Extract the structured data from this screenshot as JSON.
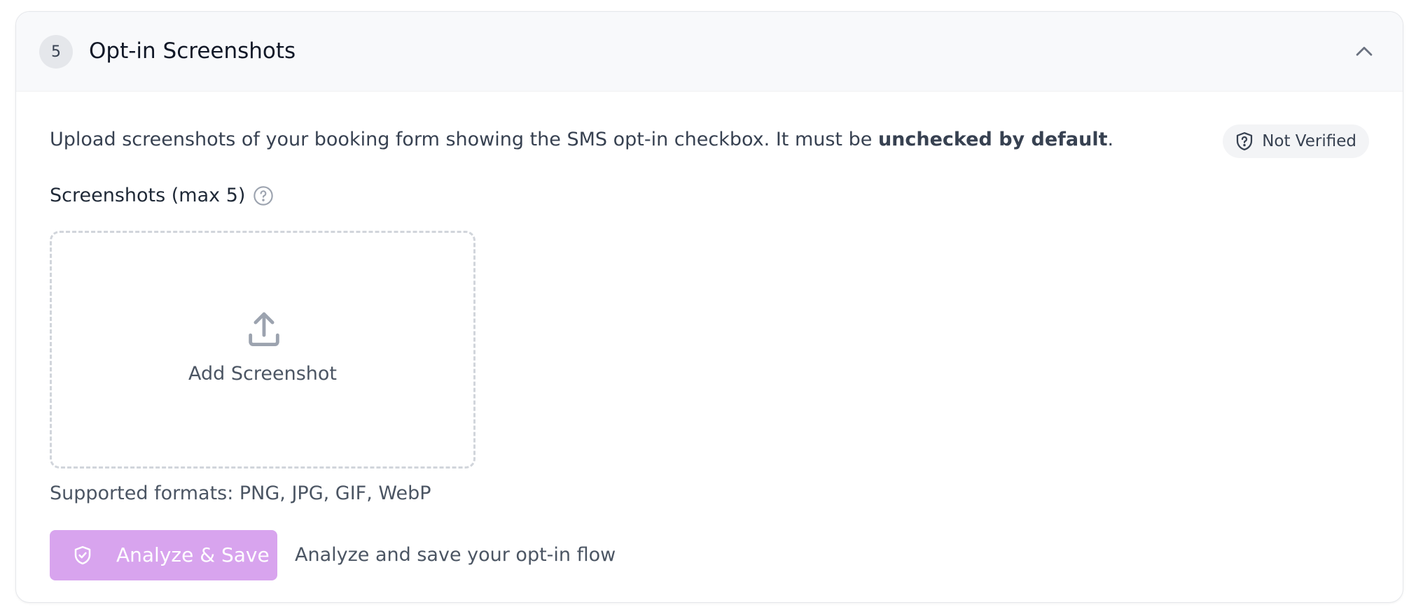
{
  "section": {
    "step_number": "5",
    "title": "Opt-in Screenshots"
  },
  "description": {
    "prefix": "Upload screenshots of your booking form showing the SMS opt-in checkbox. It must be ",
    "emphasis": "unchecked by default",
    "suffix": "."
  },
  "verification": {
    "status": "Not Verified",
    "icon": "shield-question-icon"
  },
  "screenshots": {
    "label": "Screenshots (max 5)",
    "help_icon": "question-circle-icon",
    "dropzone_label": "Add Screenshot",
    "dropzone_icon": "upload-icon",
    "formats_text": "Supported formats: PNG, JPG, GIF, WebP"
  },
  "actions": {
    "analyze_label": "Analyze & Save",
    "analyze_icon": "shield-check-icon",
    "analyze_hint": "Analyze and save your opt-in flow"
  },
  "colors": {
    "primary_button": "#d8a4ee",
    "header_bg": "#f8f9fb",
    "badge_bg": "#f3f4f6"
  }
}
